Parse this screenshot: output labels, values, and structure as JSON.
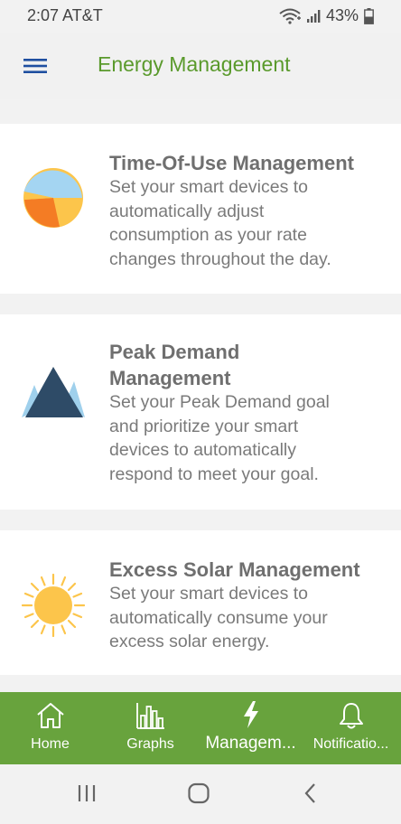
{
  "status": {
    "time": "2:07 AT&T",
    "battery": "43%",
    "icons": [
      "wifi-icon",
      "signal-icon",
      "battery-icon"
    ]
  },
  "header": {
    "title": "Energy Management",
    "menu_icon": "hamburger-menu-icon"
  },
  "cards": [
    {
      "title": "Time-Of-Use Management",
      "description_lines": [
        "Set your smart devices to",
        "automatically adjust",
        "consumption as your rate",
        "changes throughout the day."
      ],
      "icon": "pie-chart-icon"
    },
    {
      "title_lines": [
        "Peak Demand",
        "Management"
      ],
      "description_lines": [
        "Set your Peak Demand goal",
        "and prioritize your smart",
        "devices to automatically",
        "respond to meet your goal."
      ],
      "icon": "mountain-peak-icon"
    },
    {
      "title": "Excess Solar Management",
      "description_lines": [
        "Set your smart devices to",
        "automatically consume your",
        "excess solar energy."
      ],
      "icon": "sun-icon"
    }
  ],
  "bottom_nav": {
    "items": [
      {
        "label": "Home",
        "icon": "home-icon"
      },
      {
        "label": "Graphs",
        "icon": "bar-chart-icon"
      },
      {
        "label": "Managem...",
        "icon": "lightning-bolt-icon"
      },
      {
        "label": "Notificatio...",
        "icon": "bell-icon"
      }
    ],
    "active_index": 2
  },
  "system_nav": {
    "items": [
      "recents-icon",
      "home-circle-icon",
      "back-icon"
    ]
  },
  "colors": {
    "accent_green": "#68a33d",
    "title_green": "#5a9a2c",
    "menu_blue": "#1f4fa0"
  }
}
